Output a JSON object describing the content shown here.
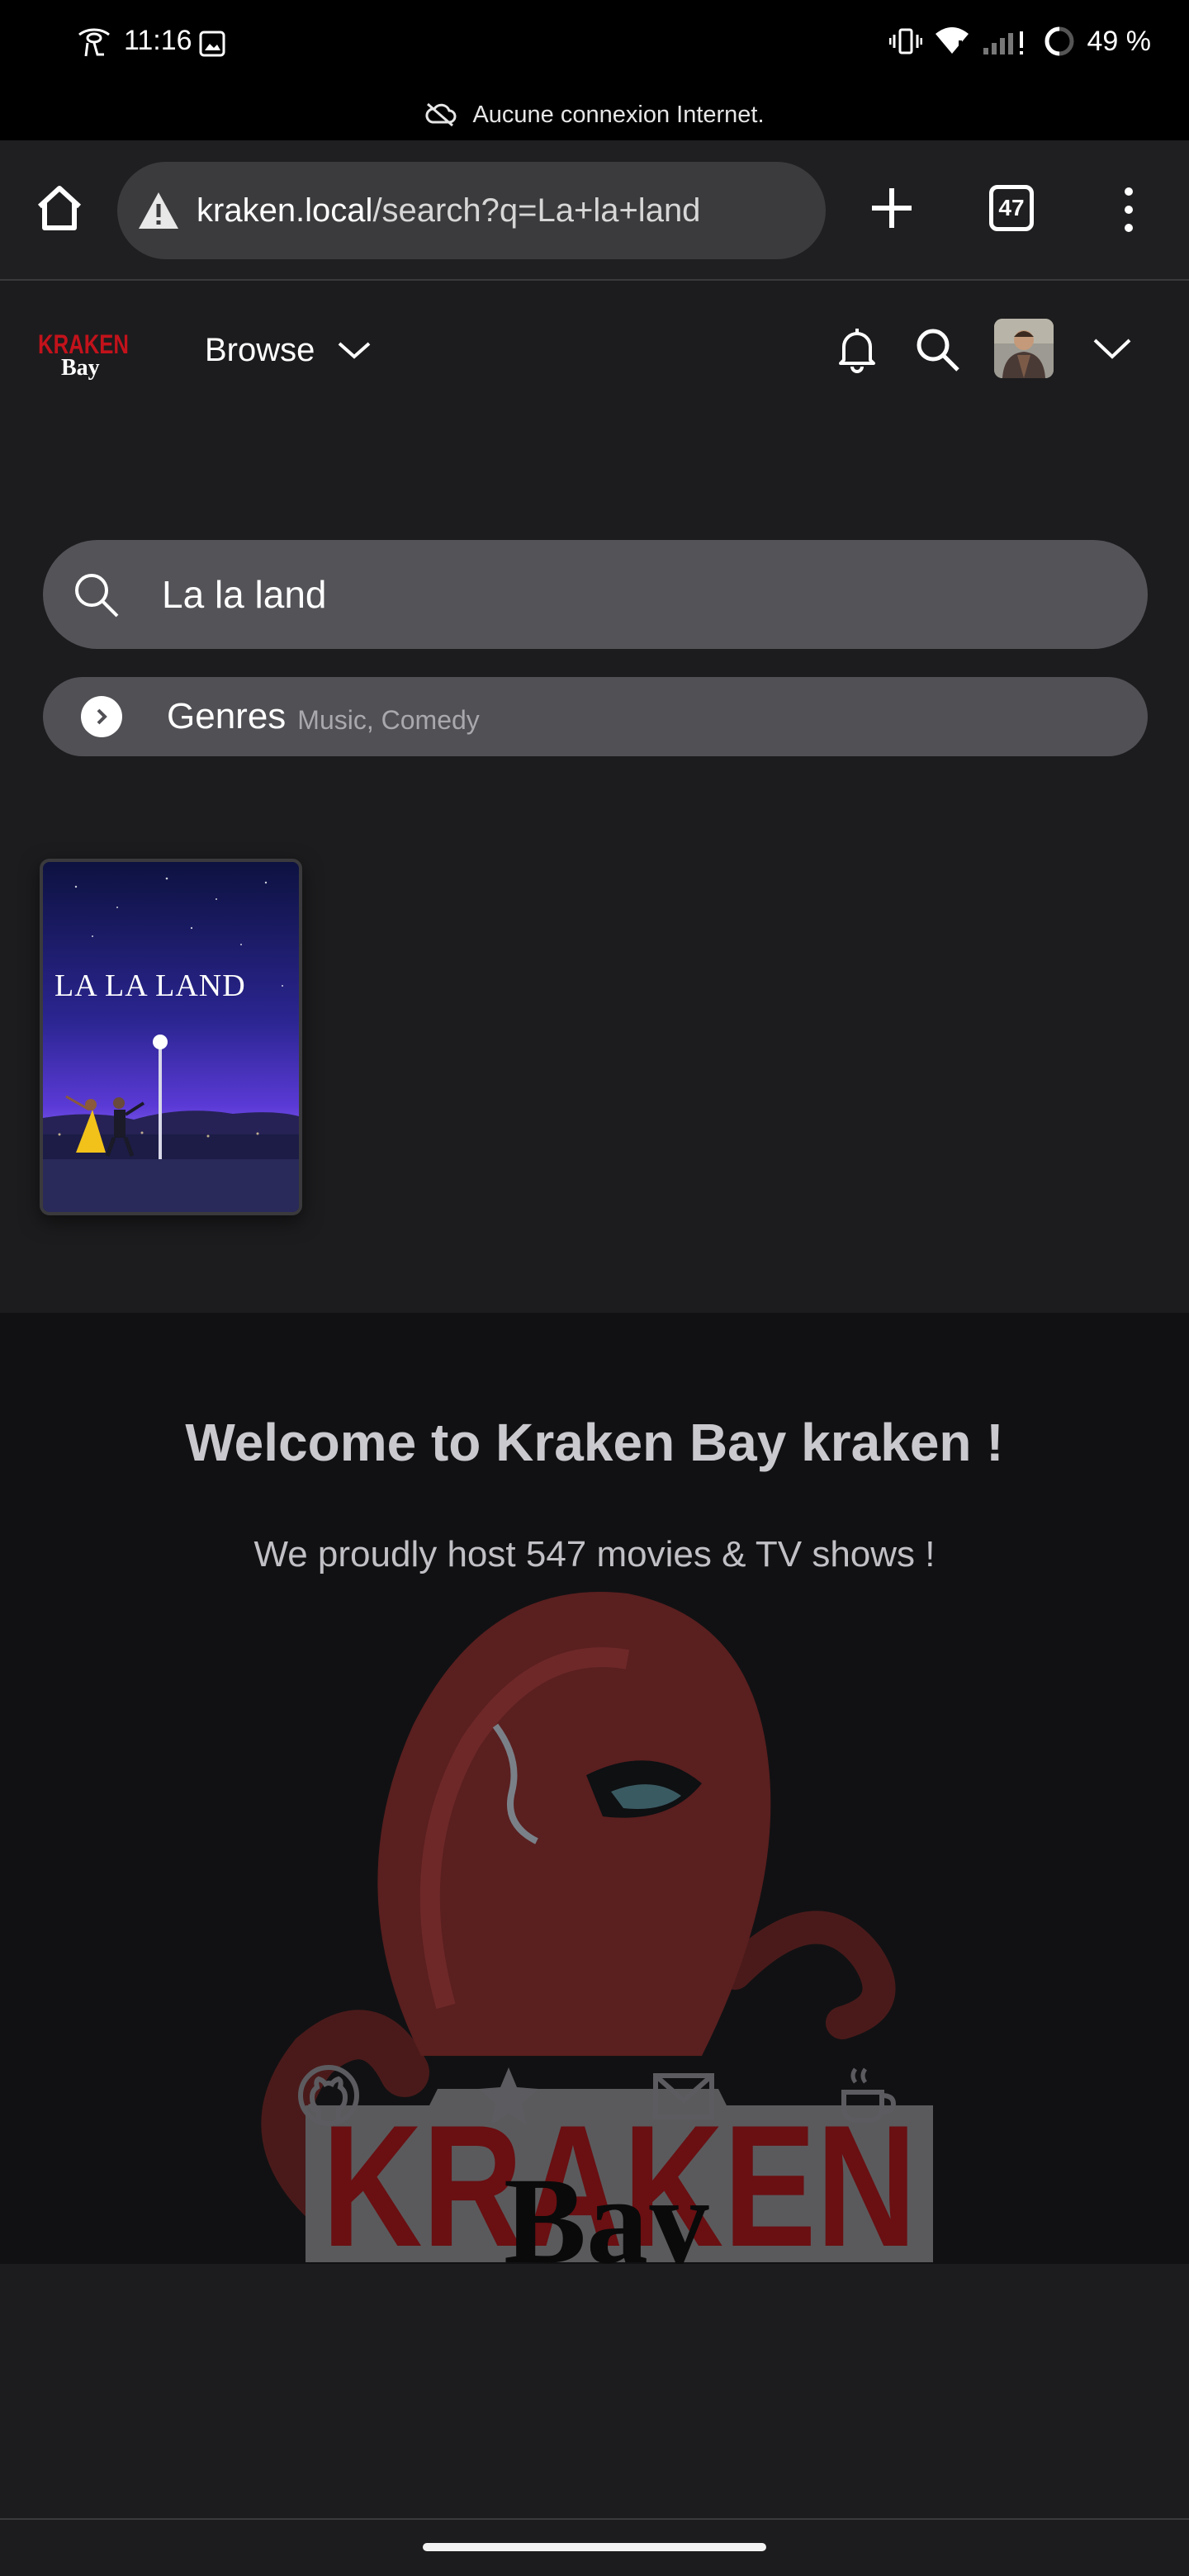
{
  "status_bar": {
    "time": "11:16",
    "battery_text": "49 %",
    "icons": [
      "eye-icon",
      "image-icon",
      "vibrate-icon",
      "wifi-icon",
      "signal-icon",
      "battery-ring-icon"
    ]
  },
  "offline_notice": {
    "icon": "cloud-off-icon",
    "text": "Aucune connexion Internet."
  },
  "browser": {
    "url_host": "kraken.local",
    "url_path": "/search?q=La+la+land",
    "tab_count": "47",
    "icons": [
      "home-icon",
      "warning-icon",
      "plus-icon",
      "tabs-icon",
      "kebab-menu-icon"
    ]
  },
  "app_header": {
    "logo_alt": "KRAKEN Bay",
    "browse_label": "Browse",
    "icons": [
      "bell-icon",
      "search-icon",
      "avatar",
      "chevron-down-icon"
    ]
  },
  "search": {
    "value": "La la land",
    "placeholder": ""
  },
  "genre_filter": {
    "label": "Genres",
    "values": "Music, Comedy"
  },
  "results": [
    {
      "title": "LA LA LAND"
    }
  ],
  "footer": {
    "welcome": "Welcome to Kraken Bay kraken !",
    "hosting": "We proudly host 547 movies & TV shows !",
    "icons": [
      "github-icon",
      "star-icon",
      "mail-icon",
      "coffee-icon"
    ]
  },
  "colors": {
    "page_bg": "#1c1c1e",
    "footer_bg": "#111113",
    "search_bg": "#535358",
    "brand_red": "#c2121b",
    "kraken_body": "#6b1f1f"
  }
}
